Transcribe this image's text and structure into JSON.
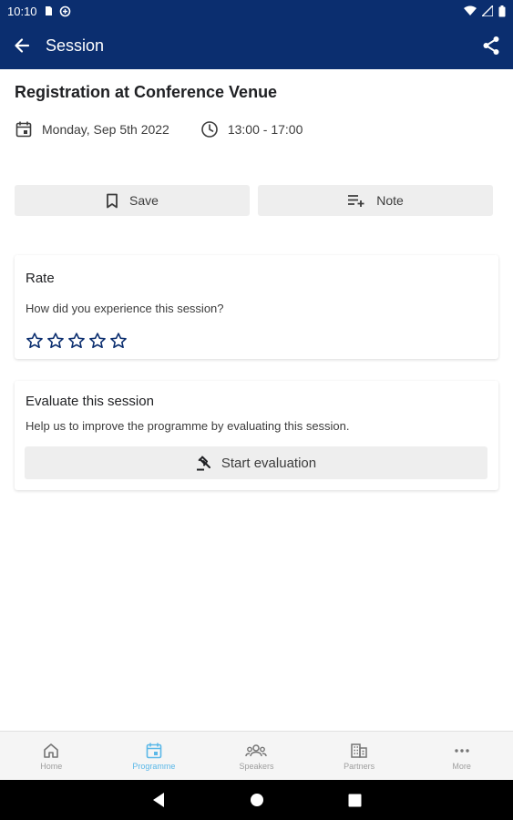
{
  "status_bar": {
    "time": "10:10"
  },
  "app_bar": {
    "title": "Session",
    "icons": [
      "back-arrow-icon",
      "share-icon"
    ]
  },
  "session": {
    "title": "Registration at Conference Venue",
    "date": "Monday, Sep 5th 2022",
    "time": "13:00 - 17:00"
  },
  "actions": {
    "save_label": "Save",
    "note_label": "Note"
  },
  "rate_card": {
    "heading": "Rate",
    "question": "How did you experience this session?",
    "stars_total": 5,
    "stars_selected": 0,
    "star_color": "#0b2e6f"
  },
  "evaluate_card": {
    "heading": "Evaluate this session",
    "description": "Help us to improve the programme by evaluating this session.",
    "button_label": "Start evaluation"
  },
  "bottom_nav": {
    "items": [
      {
        "label": "Home",
        "icon": "home-icon"
      },
      {
        "label": "Programme",
        "icon": "calendar-icon"
      },
      {
        "label": "Speakers",
        "icon": "speakers-icon"
      },
      {
        "label": "Partners",
        "icon": "building-icon"
      },
      {
        "label": "More",
        "icon": "more-icon"
      }
    ],
    "active_label": "Programme",
    "active_color": "#5bb8e8"
  },
  "colors": {
    "primary": "#0b2e6f",
    "button_bg": "#eeeeee"
  }
}
